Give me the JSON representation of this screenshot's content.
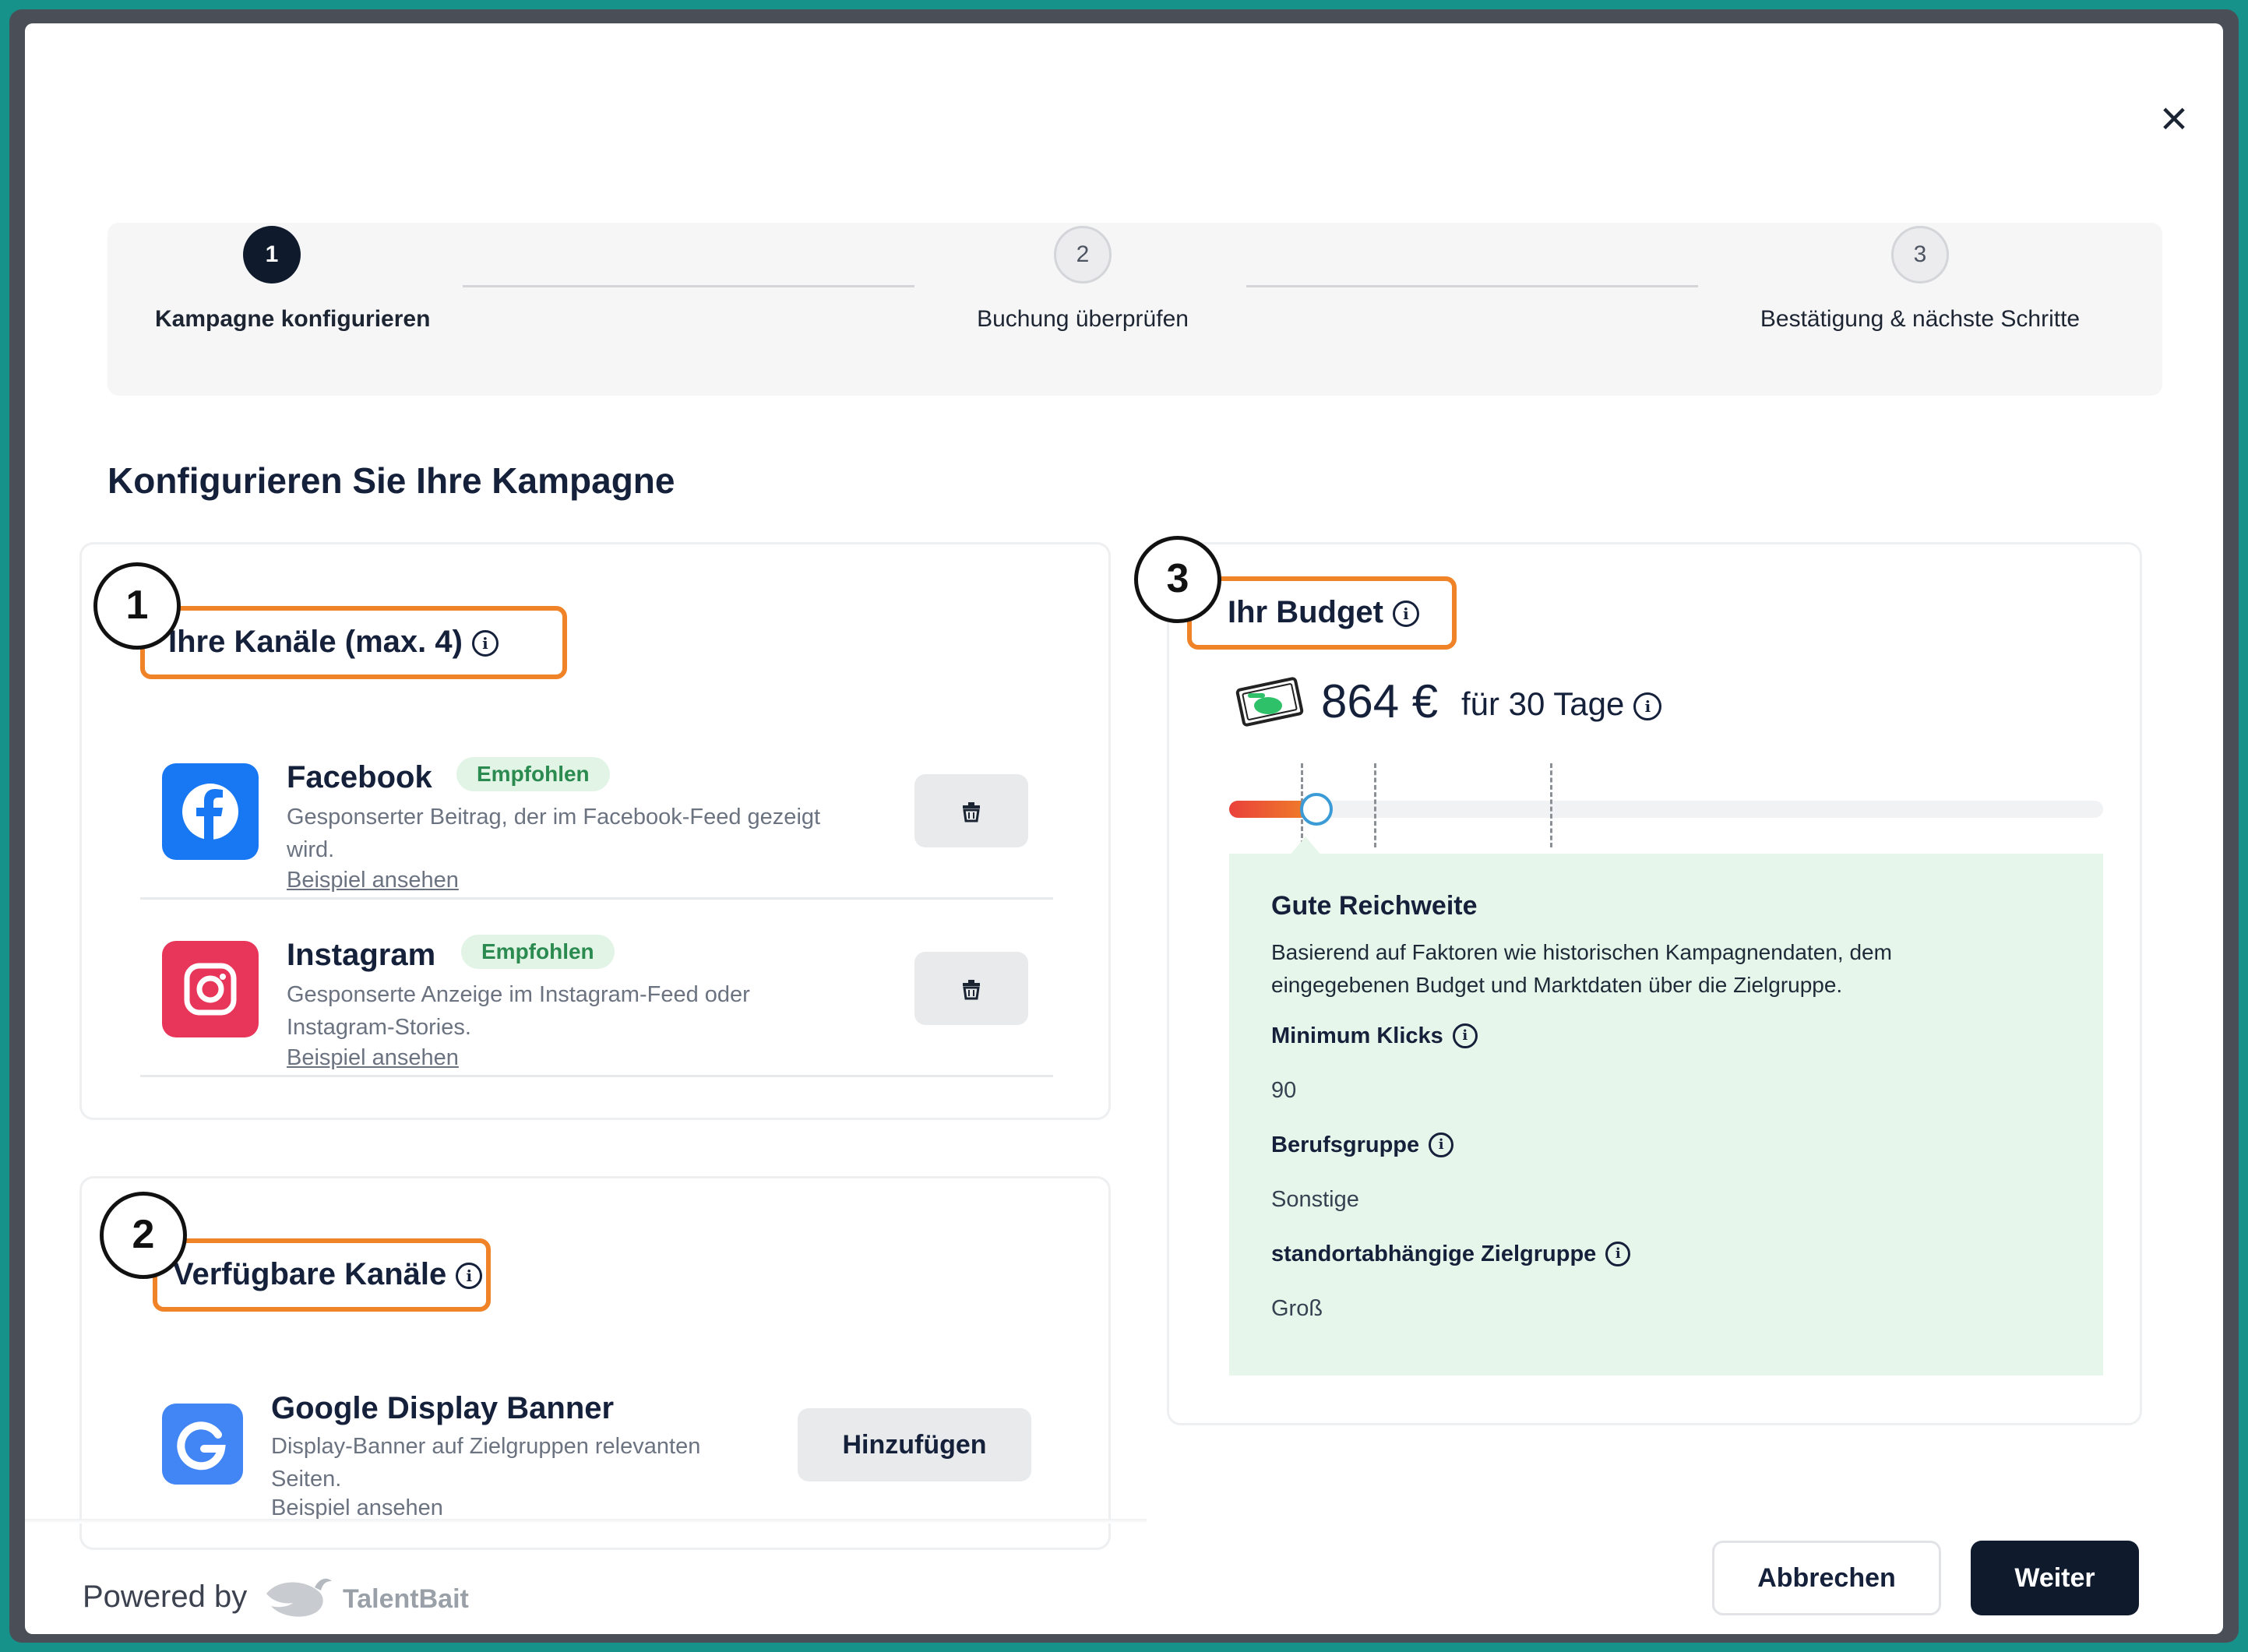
{
  "dialog": {
    "close_icon": "close-icon"
  },
  "stepper": {
    "steps": [
      {
        "number": "1",
        "label": "Kampagne konfigurieren",
        "active": true
      },
      {
        "number": "2",
        "label": "Buchung überprüfen",
        "active": false
      },
      {
        "number": "3",
        "label": "Bestätigung & nächste Schritte",
        "active": false
      }
    ]
  },
  "page_title": "Konfigurieren Sie Ihre Kampagne",
  "annotations": [
    "1",
    "2",
    "3"
  ],
  "channels": {
    "heading": "Ihre Kanäle (max. 4)",
    "items": [
      {
        "name": "Facebook",
        "badge": "Empfohlen",
        "desc_line1": "Gesponserter Beitrag, der im Facebook-Feed gezeigt",
        "desc_line2": "wird.",
        "link": "Beispiel ansehen",
        "icon": "facebook-icon",
        "color": "#1877f2"
      },
      {
        "name": "Instagram",
        "badge": "Empfohlen",
        "desc_line1": "Gesponserte Anzeige im Instagram-Feed oder",
        "desc_line2": "Instagram-Stories.",
        "link": "Beispiel ansehen",
        "icon": "instagram-icon",
        "color": "#e8355a"
      }
    ]
  },
  "available": {
    "heading": "Verfügbare Kanäle",
    "items": [
      {
        "name": "Google Display Banner",
        "desc_line1": "Display-Banner auf Zielgruppen relevanten",
        "desc_line2": "Seiten.",
        "link": "Beispiel ansehen",
        "button": "Hinzufügen",
        "icon": "google-icon",
        "color": "#4285f4"
      }
    ]
  },
  "budget": {
    "heading": "Ihr Budget",
    "amount": "864 €",
    "suffix": "für 30 Tage",
    "slider_fraction": 0.1,
    "reach": {
      "title": "Gute Reichweite",
      "desc_line1": "Basierend auf Faktoren wie historischen Kampagnendaten, dem",
      "desc_line2": "eingegebenen Budget und Marktdaten über die Zielgruppe.",
      "min_clicks_label": "Minimum Klicks",
      "min_clicks_value": "90",
      "profession_label": "Berufsgruppe",
      "profession_value": "Sonstige",
      "location_label": "standortabhängige Zielgruppe",
      "location_value": "Groß"
    }
  },
  "footer": {
    "powered_by": "Powered by",
    "brand": "TalentBait",
    "cancel": "Abbrechen",
    "next": "Weiter"
  },
  "colors": {
    "accent": "#0f1b2d",
    "highlight": "#f08327",
    "reach_bg": "#e7f6ea",
    "badge_text": "#2a8a4f"
  }
}
